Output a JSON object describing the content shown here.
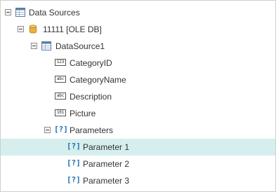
{
  "tree": {
    "root": {
      "label": "Data Sources"
    },
    "connection": {
      "label": "11111 [OLE DB]"
    },
    "datasource": {
      "label": "DataSource1"
    },
    "fields": [
      {
        "label": "CategoryID",
        "type_glyph": "123"
      },
      {
        "label": "CategoryName",
        "type_glyph": "abc"
      },
      {
        "label": "Description",
        "type_glyph": "abc"
      },
      {
        "label": "Picture",
        "type_glyph": "101"
      }
    ],
    "parameters_group": {
      "label": "Parameters",
      "icon_glyph": "[?]"
    },
    "parameters": [
      {
        "label": "Parameter 1",
        "icon_glyph": "[?]",
        "selected": true
      },
      {
        "label": "Parameter 2",
        "icon_glyph": "[?]",
        "selected": false
      },
      {
        "label": "Parameter 3",
        "icon_glyph": "[?]",
        "selected": false
      }
    ]
  },
  "colors": {
    "selection": "#d6efee",
    "param_icon": "#1f6fb4",
    "database_icon": "#e8b23a"
  }
}
